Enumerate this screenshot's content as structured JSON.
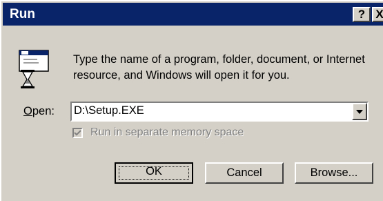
{
  "window": {
    "title": "Run"
  },
  "titlebar_buttons": {
    "help": "?",
    "close": "X"
  },
  "dialog": {
    "description": "Type the name of a program, folder, document, or Internet resource, and Windows will open it for you.",
    "open_label_accel": "O",
    "open_label_rest": "pen:",
    "open_value": "D:\\Setup.EXE",
    "checkbox_label": "Run in separate memory space",
    "checkbox_checked": true,
    "checkbox_disabled": true
  },
  "buttons": {
    "ok": "OK",
    "cancel": "Cancel",
    "browse": "Browse..."
  },
  "icons": {
    "program": "run-program-icon",
    "dropdown": "chevron-down-icon"
  }
}
